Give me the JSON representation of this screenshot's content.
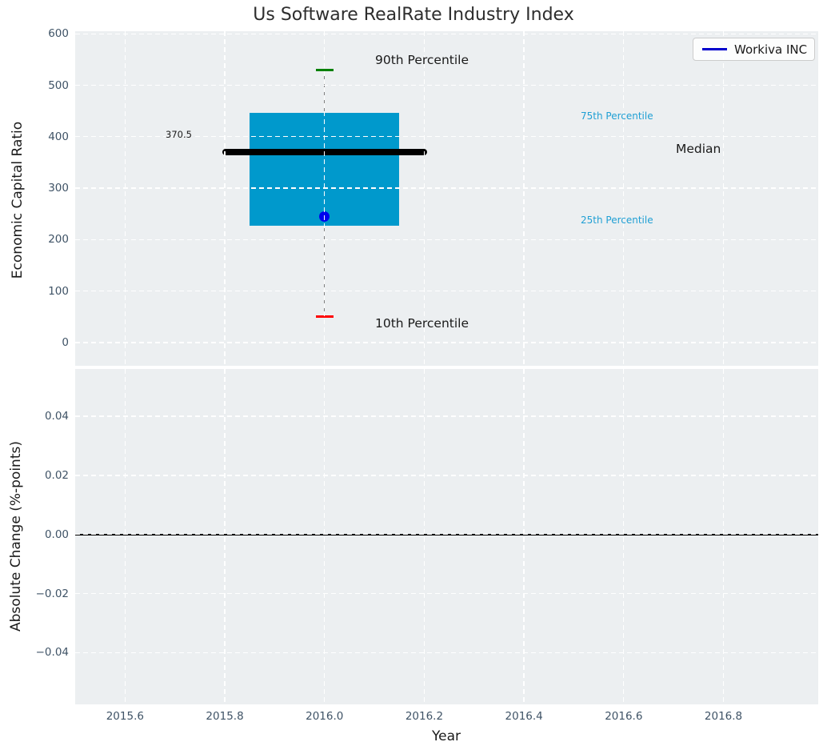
{
  "title": "Us Software RealRate Industry Index",
  "colors": {
    "panel_bg": "#eceff1",
    "grid": "#ffffff",
    "box_fill": "#0099cc",
    "median_line": "#000000",
    "whisker": "#808080",
    "cap_upper": "#008000",
    "cap_lower": "#ff0000",
    "company_marker": "#0000ee",
    "legend_line": "#0000cc",
    "percentile_label": "#1f9fd4",
    "tick_label": "#3f5366",
    "zero_line": "#000000"
  },
  "chart_data": [
    {
      "type": "boxplot",
      "title": "Us Software RealRate Industry Index",
      "ylabel": "Economic Capital Ratio",
      "x_center": 2016.0,
      "box_width": 0.3,
      "median_line_width": 0.41,
      "stats": {
        "p90": 530,
        "p75": 447,
        "median": 370.5,
        "p25": 227,
        "p10": 50
      },
      "company": {
        "name": "Workiva INC",
        "value": 245
      },
      "legend": {
        "label": "Workiva INC",
        "position": "upper right"
      },
      "annotations": {
        "p90_label": "90th Percentile",
        "p75_label": "75th Percentile",
        "median_label": "Median",
        "median_value_label": "370.5",
        "p25_label": "25th Percentile",
        "p10_label": "10th Percentile"
      },
      "yticks": {
        "values": [
          0,
          100,
          200,
          300,
          400,
          500,
          600
        ],
        "labels": [
          "0",
          "100",
          "200",
          "300",
          "400",
          "500",
          "600"
        ]
      },
      "ylim": [
        -45,
        605
      ],
      "xlim": [
        2015.5,
        2016.99
      ],
      "grid": true
    },
    {
      "type": "line",
      "ylabel": "Absolute Change (%-points)",
      "xlabel": "Year",
      "series": [],
      "zero_line": 0.0,
      "yticks": {
        "values": [
          -0.04,
          -0.02,
          0.0,
          0.02,
          0.04
        ],
        "labels": [
          "−0.04",
          "−0.02",
          "0.00",
          "0.02",
          "0.04"
        ]
      },
      "xticks": {
        "values": [
          2015.6,
          2015.8,
          2016.0,
          2016.2,
          2016.4,
          2016.6,
          2016.8
        ],
        "labels": [
          "2015.6",
          "2015.8",
          "2016.0",
          "2016.2",
          "2016.4",
          "2016.6",
          "2016.8"
        ]
      },
      "ylim": [
        -0.0575,
        0.056
      ],
      "xlim": [
        2015.5,
        2016.99
      ],
      "grid": true
    }
  ]
}
